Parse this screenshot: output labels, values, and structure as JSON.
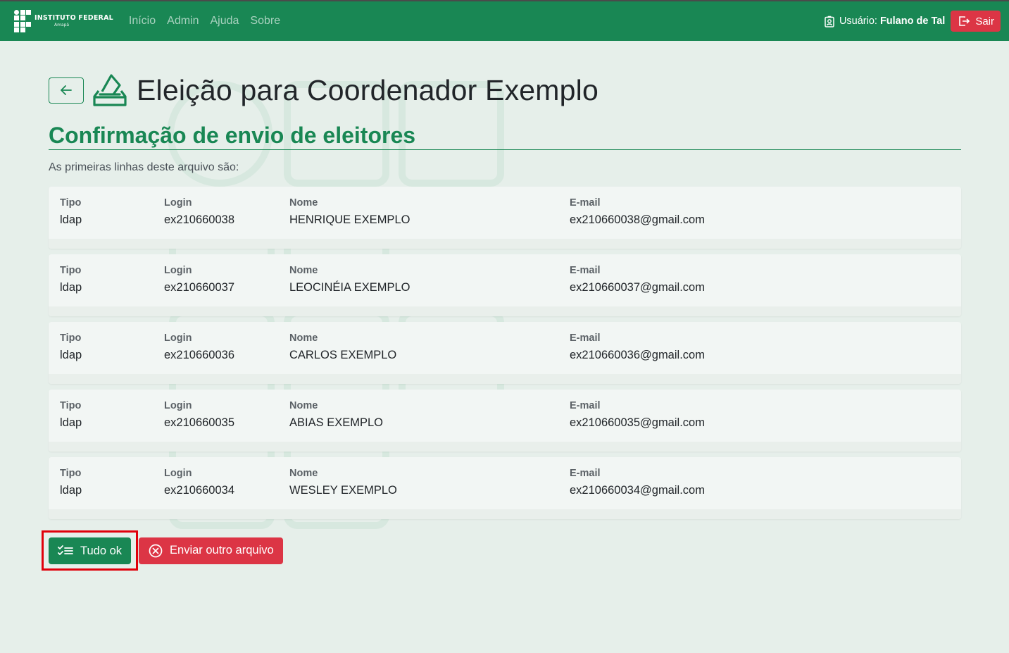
{
  "navbar": {
    "brand_title": "INSTITUTO FEDERAL",
    "brand_subtitle": "Amapá",
    "links": [
      "Início",
      "Admin",
      "Ajuda",
      "Sobre"
    ],
    "user_prefix": "Usuário:",
    "user_name": "Fulano de Tal",
    "logout_label": "Sair"
  },
  "page": {
    "title": "Eleição para Coordenador Exemplo",
    "section_title": "Confirmação de envio de eleitores",
    "intro": "As primeiras linhas deste arquivo são:"
  },
  "columns": {
    "tipo": "Tipo",
    "login": "Login",
    "nome": "Nome",
    "email": "E-mail"
  },
  "rows": [
    {
      "tipo": "ldap",
      "login": "ex210660038",
      "nome": "HENRIQUE EXEMPLO",
      "email": "ex210660038@gmail.com"
    },
    {
      "tipo": "ldap",
      "login": "ex210660037",
      "nome": "LEOCINÉIA EXEMPLO",
      "email": "ex210660037@gmail.com"
    },
    {
      "tipo": "ldap",
      "login": "ex210660036",
      "nome": "CARLOS EXEMPLO",
      "email": "ex210660036@gmail.com"
    },
    {
      "tipo": "ldap",
      "login": "ex210660035",
      "nome": "ABIAS EXEMPLO",
      "email": "ex210660035@gmail.com"
    },
    {
      "tipo": "ldap",
      "login": "ex210660034",
      "nome": "WESLEY EXEMPLO",
      "email": "ex210660034@gmail.com"
    }
  ],
  "actions": {
    "ok_label": "Tudo ok",
    "other_label": "Enviar outro arquivo"
  },
  "colors": {
    "primary": "#198754",
    "danger": "#dc3545",
    "highlight": "#e0000b",
    "background": "#e6efea"
  },
  "icons": {
    "back": "arrow-left-icon",
    "ballot": "ballot-box-icon",
    "user": "person-badge-icon",
    "logout": "box-arrow-right-icon",
    "ok": "list-check-icon",
    "other": "x-circle-icon"
  }
}
